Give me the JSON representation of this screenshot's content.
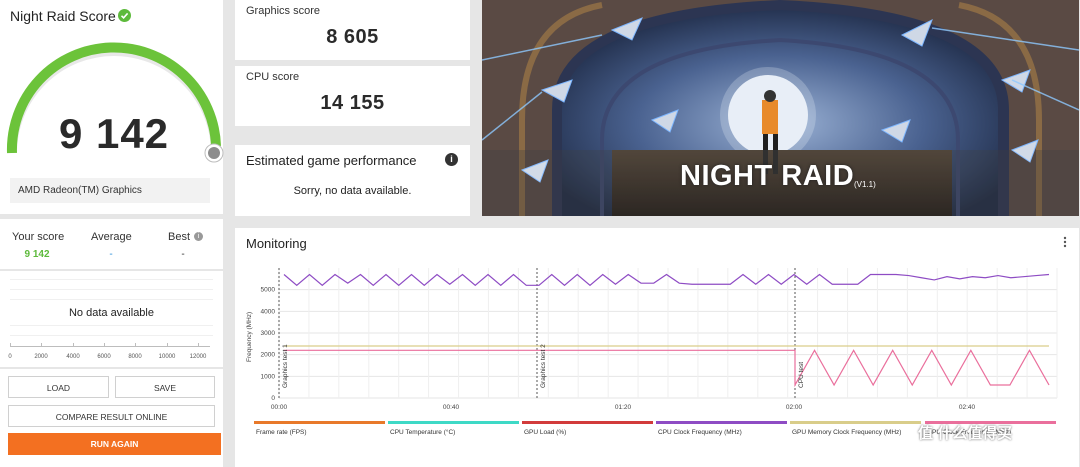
{
  "score_panel": {
    "title": "Night Raid Score",
    "score": "9 142",
    "gpu": "AMD Radeon(TM) Graphics"
  },
  "compare": {
    "your_score_label": "Your score",
    "your_score_value": "9 142",
    "average_label": "Average",
    "average_value": "-",
    "best_label": "Best",
    "best_value": "-"
  },
  "histogram": {
    "no_data": "No data available",
    "ticks": [
      "0",
      "2000",
      "4000",
      "6000",
      "8000",
      "10000",
      "12000"
    ]
  },
  "buttons": {
    "load": "LOAD",
    "save": "SAVE",
    "compare_online": "COMPARE RESULT ONLINE",
    "run_again": "RUN AGAIN"
  },
  "graphics_card": {
    "label": "Graphics score",
    "value": "8 605"
  },
  "cpu_card": {
    "label": "CPU score",
    "value": "14 155"
  },
  "estimated": {
    "title": "Estimated game performance",
    "body": "Sorry, no data available."
  },
  "banner": {
    "title": "NIGHT RAID",
    "version": "(V1.1)"
  },
  "monitoring": {
    "title": "Monitoring",
    "y_axis_label": "Frequency (MHz)",
    "y_ticks": [
      "5000",
      "4000",
      "3000",
      "2000",
      "1000",
      "0"
    ],
    "x_ticks": [
      "00:00",
      "00:40",
      "01:20",
      "02:00",
      "02:40"
    ],
    "section_labels": [
      "Graphics test 1",
      "Graphics test 2",
      "CPU test"
    ],
    "legend": [
      {
        "label": "Frame rate (FPS)",
        "color": "#e8792a"
      },
      {
        "label": "CPU Temperature (°C)",
        "color": "#3ed9c6"
      },
      {
        "label": "GPU Load (%)",
        "color": "#d23b3b"
      },
      {
        "label": "CPU Clock Frequency (MHz)",
        "color": "#8e4cc4"
      },
      {
        "label": "GPU Memory Clock Frequency (MHz)",
        "color": "#d9cd8a"
      },
      {
        "label": "GPU Clock Frequency (MHz)",
        "color": "#ea6f9c"
      }
    ]
  },
  "chart_data": {
    "type": "line",
    "xlabel": "",
    "ylabel": "Frequency (MHz)",
    "ylim": [
      0,
      6000
    ],
    "x_ticks": [
      "00:00",
      "00:40",
      "01:20",
      "02:00",
      "02:40"
    ],
    "grid": true,
    "series": [
      {
        "name": "CPU Clock Frequency (MHz)",
        "values": [
          5700,
          5200,
          5700,
          5200,
          5700,
          5300,
          5700,
          5200,
          5700,
          5200,
          5700,
          5200,
          5700,
          5250,
          5700,
          5200,
          5700,
          5200,
          5700,
          5200,
          5200,
          5700,
          5200,
          5700,
          5200,
          5700,
          5250,
          5700,
          5300,
          5300,
          5700,
          5300,
          5250,
          5250,
          5250,
          5250,
          5700,
          5250,
          5700,
          5250,
          5700,
          5250,
          5700,
          5250,
          5250,
          5250,
          5700,
          5700,
          5700,
          5650,
          5550,
          5450,
          5600,
          5500,
          5600,
          5550,
          5650,
          5550,
          5600,
          5650,
          5700
        ]
      },
      {
        "name": "GPU Memory Clock Frequency (MHz)",
        "values": [
          2400,
          2400,
          2400,
          2400,
          2400
        ]
      },
      {
        "name": "GPU Clock Frequency (MHz)",
        "values": [
          2200,
          2200,
          2200,
          2200,
          2200,
          2200,
          2200,
          2200,
          600,
          2200,
          600,
          2200,
          600,
          2200,
          600,
          2200,
          600,
          2200,
          600,
          600,
          2200,
          600
        ]
      }
    ]
  }
}
